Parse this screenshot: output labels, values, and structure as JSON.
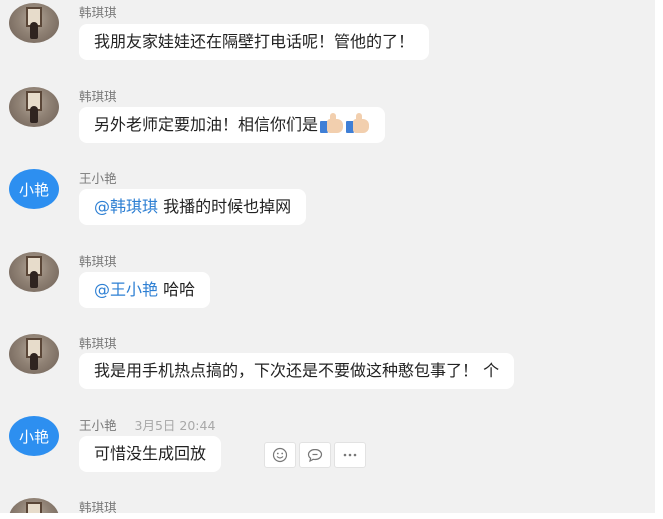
{
  "messages": [
    {
      "sender": "韩琪琪",
      "avatar": "photo",
      "text": "我朋友家娃娃还在隔壁打电话呢！管他的了！"
    },
    {
      "sender": "韩琪琪",
      "avatar": "photo",
      "text": "另外老师定要加油！相信你们是",
      "icons": [
        "thumbs-up-icon",
        "thumbs-up-icon"
      ]
    },
    {
      "sender": "王小艳",
      "avatar": "text",
      "avatar_text": "小艳",
      "mention": "@韩琪琪",
      "text": " 我播的时候也掉网"
    },
    {
      "sender": "韩琪琪",
      "avatar": "photo",
      "mention": "@王小艳",
      "text": " 哈哈"
    },
    {
      "sender": "韩琪琪",
      "avatar": "photo",
      "text": "我是用手机热点搞的，下次还是不要做这种憨包事了！ 个"
    },
    {
      "sender": "王小艳",
      "avatar": "text",
      "avatar_text": "小艳",
      "time": "3月5日 20:44",
      "text": "可惜没生成回放"
    },
    {
      "sender": "韩琪琪",
      "avatar": "photo"
    }
  ],
  "hover_actions": [
    "emoji-icon",
    "reply-icon",
    "more-icon"
  ],
  "colors": {
    "background": "#f1f1f1",
    "bubble": "#ffffff",
    "mention": "#2d7fd3",
    "avatar_blue": "#2d8ff0"
  }
}
